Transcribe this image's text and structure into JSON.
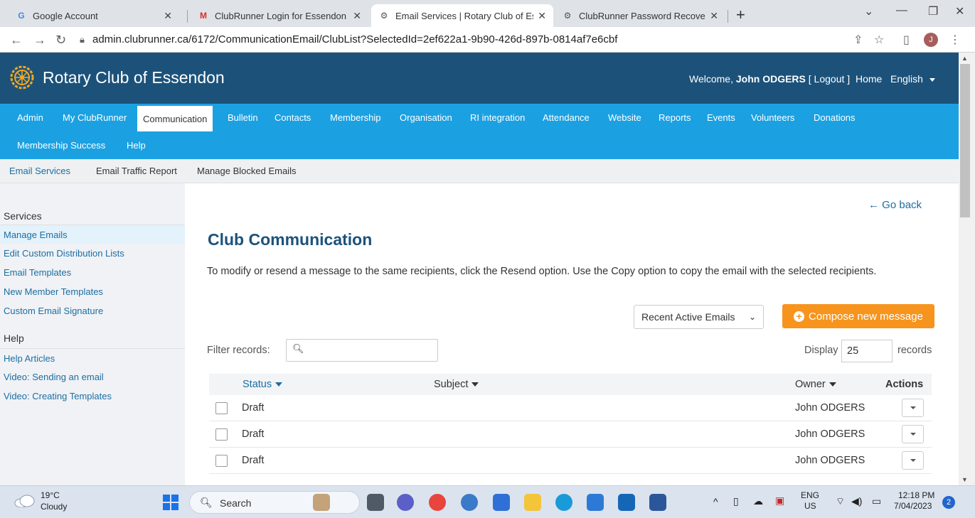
{
  "browser": {
    "tabs": [
      {
        "title": "Google Account",
        "favicon": "G"
      },
      {
        "title": "ClubRunner Login for Essendon \\",
        "favicon": "M"
      },
      {
        "title": "Email Services | Rotary Club of Es",
        "favicon": "rotary"
      },
      {
        "title": "ClubRunner Password Recovery E",
        "favicon": "rotary"
      }
    ],
    "url": "admin.clubrunner.ca/6172/CommunicationEmail/ClubList?SelectedId=2ef622a1-9b90-426d-897b-0814af7e6cbf",
    "profile_initial": "J"
  },
  "header": {
    "site_title": "Rotary Club of Essendon",
    "welcome_prefix": "Welcome,",
    "user_name": "John ODGERS",
    "logout": "[ Logout ]",
    "home": "Home",
    "language": "English"
  },
  "main_nav": [
    "Admin",
    "My ClubRunner",
    "Communication",
    "Bulletin",
    "Contacts",
    "Membership",
    "Organisation",
    "RI integration",
    "Attendance",
    "Website",
    "Reports",
    "Events",
    "Volunteers",
    "Donations",
    "Membership Success",
    "Help"
  ],
  "sub_nav": [
    "Email Services",
    "Email Traffic Report",
    "Manage Blocked Emails"
  ],
  "sidebar": {
    "services_heading": "Services",
    "services": [
      "Manage Emails",
      "Edit Custom Distribution Lists",
      "Email Templates",
      "New Member Templates",
      "Custom Email Signature"
    ],
    "help_heading": "Help",
    "help": [
      "Help Articles",
      "Video: Sending an email",
      "Video: Creating Templates"
    ]
  },
  "content": {
    "go_back": "Go back",
    "title": "Club Communication",
    "intro": "To modify or resend a message to the same recipients, click the Resend option. Use the Copy option to copy the email with the selected recipients.",
    "filter_select": "Recent Active Emails",
    "compose": "Compose new message",
    "filter_label": "Filter records:",
    "filter_placeholder": "",
    "display_label": "Display",
    "display_value": "25",
    "records_label": "records",
    "columns": {
      "status": "Status",
      "subject": "Subject",
      "owner": "Owner",
      "actions": "Actions"
    },
    "rows": [
      {
        "status": "Draft",
        "subject": "",
        "owner": "John ODGERS"
      },
      {
        "status": "Draft",
        "subject": "",
        "owner": "John ODGERS"
      },
      {
        "status": "Draft",
        "subject": "",
        "owner": "John ODGERS"
      }
    ]
  },
  "taskbar": {
    "temp": "19°C",
    "weather": "Cloudy",
    "search": "Search",
    "lang": "ENG",
    "region": "US",
    "time": "12:18 PM",
    "date": "7/04/2023",
    "notifications": "2"
  },
  "colors": {
    "header_blue": "#1c527a",
    "nav_cyan": "#1ba1e2",
    "accent_orange": "#f7941d",
    "link_blue": "#1c6ea4"
  }
}
